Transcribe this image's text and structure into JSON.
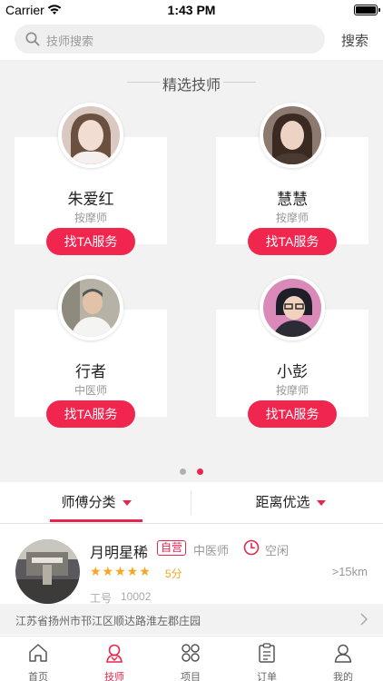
{
  "status_bar": {
    "carrier": "Carrier",
    "time": "1:43 PM"
  },
  "search": {
    "placeholder": "技师搜索",
    "button": "搜索"
  },
  "featured": {
    "title": "精选技师",
    "book_label": "找TA服务",
    "technicians": [
      {
        "name": "朱爱红",
        "role": "按摩师"
      },
      {
        "name": "慧慧",
        "role": "按摩师"
      },
      {
        "name": "行者",
        "role": "中医师"
      },
      {
        "name": "小彭",
        "role": "按摩师"
      }
    ],
    "page_indicator": {
      "count": 2,
      "active_index": 1
    }
  },
  "filters": [
    {
      "label": "师傅分类",
      "active": true
    },
    {
      "label": "距离优选",
      "active": false
    }
  ],
  "list": [
    {
      "name": "月明星稀",
      "badge": "自营",
      "role": "中医师",
      "status": "空闲",
      "stars": "★★★★★",
      "rating": 5,
      "score": "5分",
      "distance": ">15km",
      "id_label": "工号",
      "id_value": "10002",
      "address": "江苏省扬州市邗江区顺达路淮左郡庄园"
    }
  ],
  "bottom_nav": [
    {
      "label": "首页",
      "icon": "home-icon"
    },
    {
      "label": "技师",
      "icon": "technician-icon",
      "active": true
    },
    {
      "label": "项目",
      "icon": "grid-icon"
    },
    {
      "label": "订单",
      "icon": "clipboard-icon"
    },
    {
      "label": "我的",
      "icon": "user-icon"
    }
  ],
  "colors": {
    "accent": "#e8264d",
    "button": "#f0264f",
    "star": "#f5a623",
    "section_bg": "#f2f2f2"
  }
}
